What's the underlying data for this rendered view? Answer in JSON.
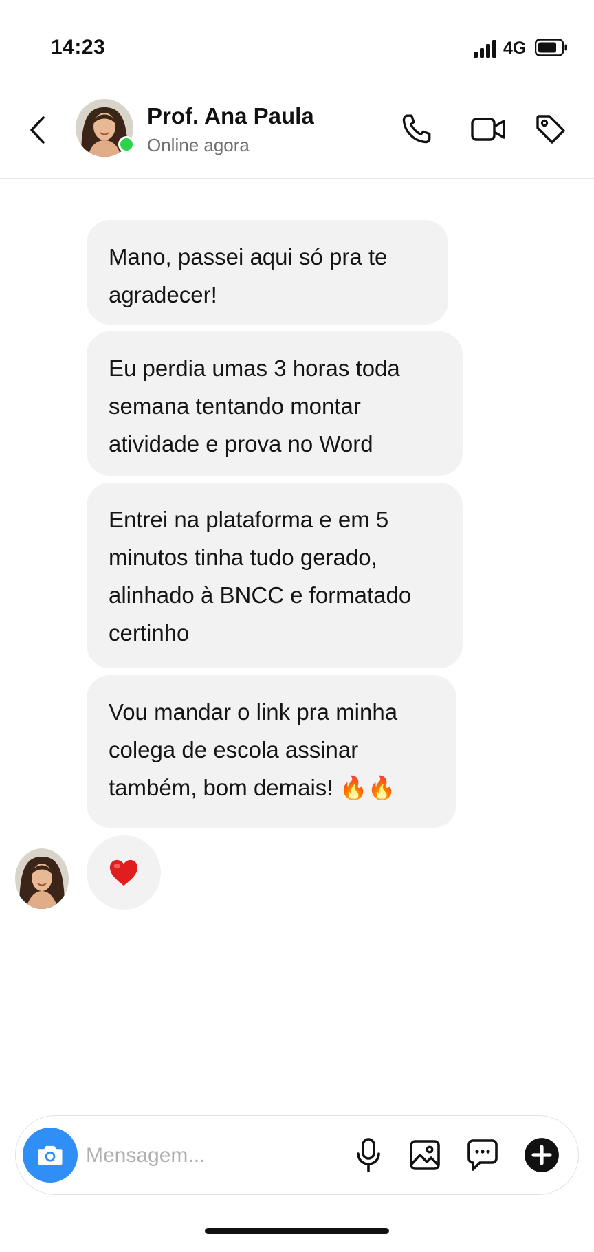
{
  "status_bar": {
    "time": "14:23",
    "network": "4G",
    "signal_icon": "signal-bars-icon",
    "battery_icon": "battery-icon"
  },
  "header": {
    "back_icon": "chevron-left-icon",
    "contact_name": "Prof. Ana Paula",
    "contact_status": "Online agora",
    "online_color": "#2bd24a",
    "actions": [
      "phone-icon",
      "video-camera-icon",
      "tag-icon"
    ]
  },
  "messages": [
    {
      "text": "Mano, passei aqui só pra te agradecer!"
    },
    {
      "text": "Eu perdia umas 3 horas toda semana tentando montar atividade e prova no Word"
    },
    {
      "text": "Entrei na plataforma e em 5 minutos tinha tudo gerado, alinhado à BNCC e formatado certinho"
    },
    {
      "text": "Vou mandar o link pra minha colega de escola assinar também, bom demais! 🔥🔥"
    }
  ],
  "reply": {
    "emoji_icon": "red-heart-icon"
  },
  "composer": {
    "placeholder": "Mensagem...",
    "camera_icon": "camera-icon",
    "camera_color": "#2f8ff6",
    "icons": [
      "microphone-icon",
      "image-icon",
      "sticker-chat-icon",
      "plus-circle-icon"
    ]
  },
  "colors": {
    "bubble_bg": "#f2f2f2",
    "text": "#111111",
    "muted": "#707070"
  }
}
